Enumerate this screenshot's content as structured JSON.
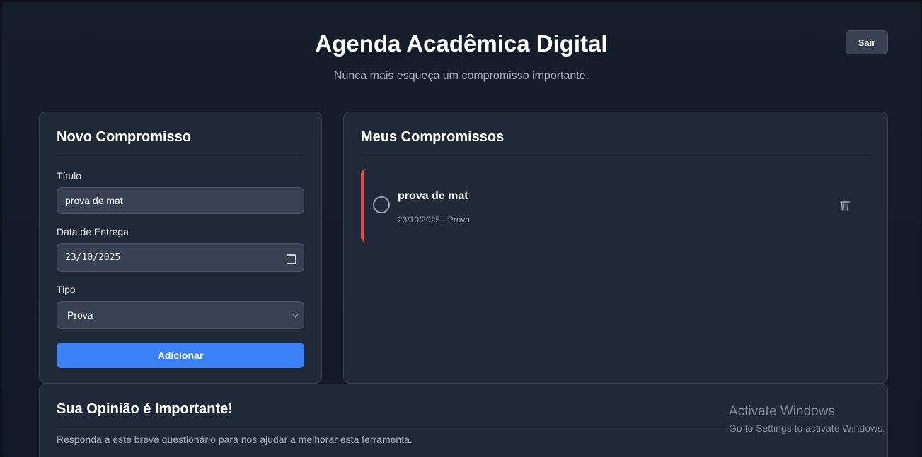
{
  "header": {
    "title": "Agenda Acadêmica Digital",
    "subtitle": "Nunca mais esqueça um compromisso importante.",
    "logout_label": "Sair"
  },
  "form": {
    "heading": "Novo Compromisso",
    "title_label": "Título",
    "title_value": "prova de mat",
    "date_label": "Data de Entrega",
    "date_value": "23/10/2025",
    "type_label": "Tipo",
    "type_value": "Prova",
    "submit_label": "Adicionar"
  },
  "list": {
    "heading": "Meus Compromissos",
    "items": [
      {
        "title": "prova de mat",
        "meta": "23/10/2025 - Prova",
        "accent": "#ef4444",
        "done": false
      }
    ]
  },
  "feedback": {
    "heading": "Sua Opinião é Importante!",
    "description": "Responda a este breve questionário para nos ajudar a melhorar esta ferramenta."
  },
  "watermark": {
    "line1": "Activate Windows",
    "line2": "Go to Settings to activate Windows."
  },
  "colors": {
    "accent": "#3b82f6",
    "priority": "#ef4444",
    "background": "#111827",
    "card": "#1f2937"
  }
}
